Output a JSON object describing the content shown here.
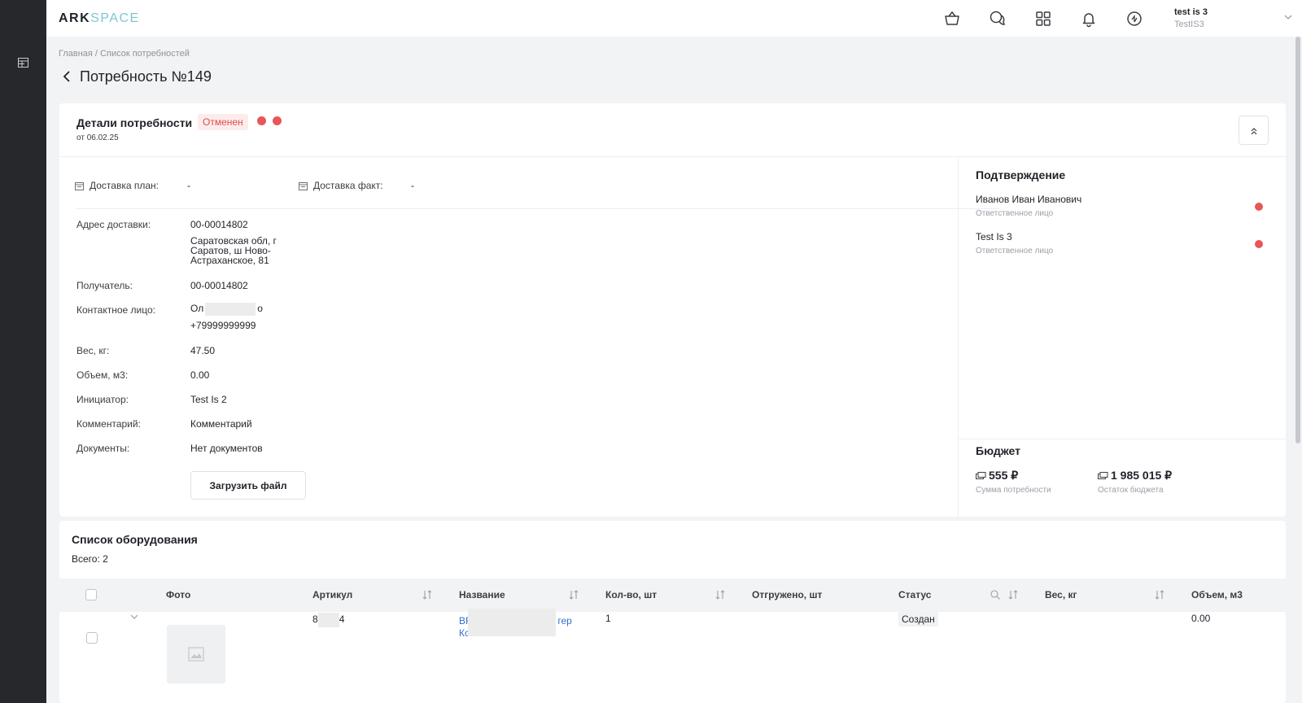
{
  "app": {
    "logo_part1": "ARK",
    "logo_part2": "SPACE"
  },
  "sidebar": {
    "icons": [
      "table-icon"
    ]
  },
  "header": {
    "icons": [
      "basket-icon",
      "chat-icon",
      "apps-grid-icon",
      "bell-icon",
      "sync-icon"
    ],
    "user_name": "test is 3",
    "user_org": "TestIS3"
  },
  "breadcrumb": {
    "home": "Главная",
    "separator": " / ",
    "current": "Список потребностей"
  },
  "page": {
    "title": "Потребность №149"
  },
  "details": {
    "title": "Детали потребности",
    "date": "от 06.02.25",
    "status": "Отменен",
    "status_color": "#e04b4b",
    "delivery_plan_label": "Доставка план:",
    "delivery_plan_value": "-",
    "delivery_fact_label": "Доставка факт:",
    "delivery_fact_value": "-",
    "address_label": "Адрес доставки:",
    "address_code": "00-00014802",
    "address_line1": "Саратовская обл, г",
    "address_line2": "Саратов, ш Ново-",
    "address_line3": "Астраханское, 81",
    "recipient_label": "Получатель:",
    "recipient_value": "00-00014802",
    "contact_label": "Контактное лицо:",
    "contact_name_start": "Ол",
    "contact_name_end": "о",
    "contact_phone": "+79999999999",
    "weight_label": "Вес, кг:",
    "weight_value": "47.50",
    "volume_label": "Объем, м3:",
    "volume_value": "0.00",
    "initiator_label": "Инициатор:",
    "initiator_value": "Test Is 2",
    "comment_label": "Комментарий:",
    "comment_value": "Комментарий",
    "documents_label": "Документы:",
    "documents_value": "Нет документов",
    "upload_button": "Загрузить файл"
  },
  "confirmation": {
    "title": "Подтверждение",
    "people": [
      {
        "name": "Иванов Иван Иванович",
        "role": "Ответственное лицо"
      },
      {
        "name": "Test Is 3",
        "role": "Ответственное лицо"
      }
    ]
  },
  "budget": {
    "title": "Бюджет",
    "need_sum": "555 ₽",
    "need_sum_label": "Сумма потребности",
    "remaining": "1 985 015 ₽",
    "remaining_label": "Остаток бюджета"
  },
  "equipment": {
    "title": "Список оборудования",
    "total": "Всего: 2",
    "columns": [
      "Фото",
      "Артикул",
      "Название",
      "Кол-во, шт",
      "Отгружено, шт",
      "Статус",
      "Вес, кг",
      "Объем, м3"
    ],
    "rows": [
      {
        "article_start": "8",
        "article_end": "4",
        "name_line1_start": "BF",
        "name_line1_end": "гер",
        "name_line2_start": "Кс",
        "quantity": "1",
        "shipped": "",
        "status": "Создан",
        "weight": "",
        "volume": "0.00"
      }
    ]
  }
}
